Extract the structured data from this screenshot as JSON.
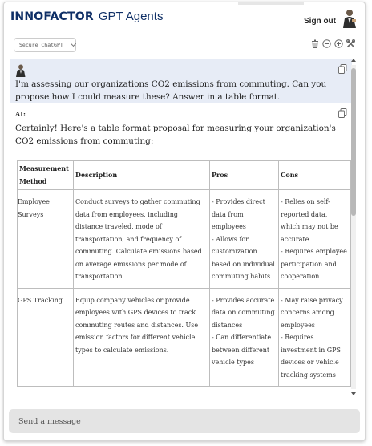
{
  "header": {
    "brand_logo": "INNOFACTOR",
    "brand_title": "GPT Agents",
    "signout_label": "Sign out"
  },
  "toolbar": {
    "model_select_value": "Secure ChatGPT",
    "icons": [
      "trash-icon",
      "minus-circle-icon",
      "plus-circle-icon",
      "tools-icon"
    ]
  },
  "conversation": {
    "user_message": "I'm assessing our organizations CO2 emissions from commuting. Can you propose how I could measure these? Answer in a table format.",
    "ai_label": "AI:",
    "ai_intro": "Certainly! Here's a table format proposal for measuring your organization's CO2 emissions from commuting:",
    "table": {
      "headers": [
        "Measurement Method",
        "Description",
        "Pros",
        "Cons"
      ],
      "rows": [
        {
          "method": "Employee Surveys",
          "description": "Conduct surveys to gather commuting data from employees, including distance traveled, mode of transportation, and frequency of commuting. Calculate emissions based on average emissions per mode of transportation.",
          "pros": [
            "- Provides direct data from employees",
            "- Allows for customization based on individual commuting habits"
          ],
          "cons": [
            "- Relies on self-reported data, which may not be accurate",
            "- Requires employee participation and cooperation"
          ]
        },
        {
          "method": "GPS Tracking",
          "description": "Equip company vehicles or provide employees with GPS devices to track commuting routes and distances. Use emission factors for different vehicle types to calculate emissions.",
          "pros": [
            "- Provides accurate data on commuting distances",
            "- Can differentiate between different vehicle types"
          ],
          "cons": [
            "- May raise privacy concerns among employees",
            "- Requires investment in GPS devices or vehicle tracking systems"
          ]
        }
      ]
    }
  },
  "input": {
    "placeholder": "Send a message"
  },
  "colors": {
    "brand": "#0f2f66",
    "user_bubble": "#e7ecf6",
    "input_bg": "#e4e4e4"
  }
}
